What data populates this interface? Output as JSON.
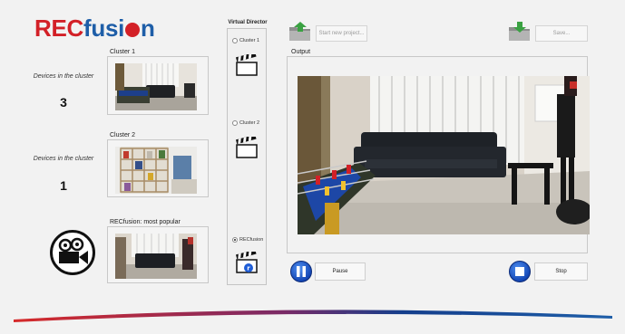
{
  "app": {
    "logo": {
      "rec": "REC",
      "fusion_a": "fusi",
      "fusion_b": "n"
    },
    "colors": {
      "brand_red": "#d32027",
      "brand_blue": "#1e5ea8",
      "button_blue": "#1f5dd6"
    }
  },
  "toolbar": {
    "new_project_label": "Start new project...",
    "save_label": "Save...",
    "new_project_icon": "folder-up-arrow-icon",
    "save_icon": "folder-down-arrow-icon"
  },
  "clusters": [
    {
      "title": "Cluster 1",
      "devices_label": "Devices in the cluster",
      "device_count": "3"
    },
    {
      "title": "Cluster 2",
      "devices_label": "Devices in the cluster",
      "device_count": "1"
    },
    {
      "title": "RECfusion: most popular"
    }
  ],
  "virtual_director": {
    "title": "Virtual Director",
    "options": [
      {
        "label": "Cluster 1",
        "checked": false
      },
      {
        "label": "Cluster 2",
        "checked": false
      },
      {
        "label": "RECfusion",
        "checked": true
      }
    ]
  },
  "output": {
    "label": "Output"
  },
  "controls": {
    "pause_label": "Pause",
    "stop_label": "Stop"
  }
}
